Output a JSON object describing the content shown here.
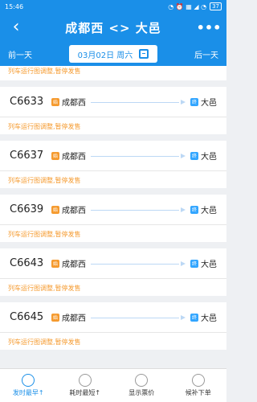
{
  "status": {
    "time": "15:46",
    "battery": "37",
    "signals": "◔ ⏰ ▦ ◢ ◔"
  },
  "header": {
    "title": "成都西 <> 大邑",
    "back_icon": "‹",
    "more_icon": "•••"
  },
  "datebar": {
    "prev": "前一天",
    "date": "03月02日 周六",
    "next": "后一天"
  },
  "top_notice": "列车运行图调整,暂停发售",
  "trains": [
    {
      "no": "C6633",
      "from": "成都西",
      "to": "大邑",
      "notice": "列车运行图调整,暂停发售",
      "start_badge": "始",
      "end_badge": "终"
    },
    {
      "no": "C6637",
      "from": "成都西",
      "to": "大邑",
      "notice": "列车运行图调整,暂停发售",
      "start_badge": "始",
      "end_badge": "终"
    },
    {
      "no": "C6639",
      "from": "成都西",
      "to": "大邑",
      "notice": "列车运行图调整,暂停发售",
      "start_badge": "始",
      "end_badge": "终"
    },
    {
      "no": "C6643",
      "from": "成都西",
      "to": "大邑",
      "notice": "列车运行图调整,暂停发售",
      "start_badge": "始",
      "end_badge": "终"
    },
    {
      "no": "C6645",
      "from": "成都西",
      "to": "大邑",
      "notice": "列车运行图调整,暂停发售",
      "start_badge": "始",
      "end_badge": "终"
    }
  ],
  "bottom": [
    {
      "label": "发时最早↑",
      "icon": "clock-icon"
    },
    {
      "label": "耗时最短↑",
      "icon": "timer-icon"
    },
    {
      "label": "显示票价",
      "icon": "price-tag-icon"
    },
    {
      "label": "候补下单",
      "icon": "order-icon"
    }
  ]
}
